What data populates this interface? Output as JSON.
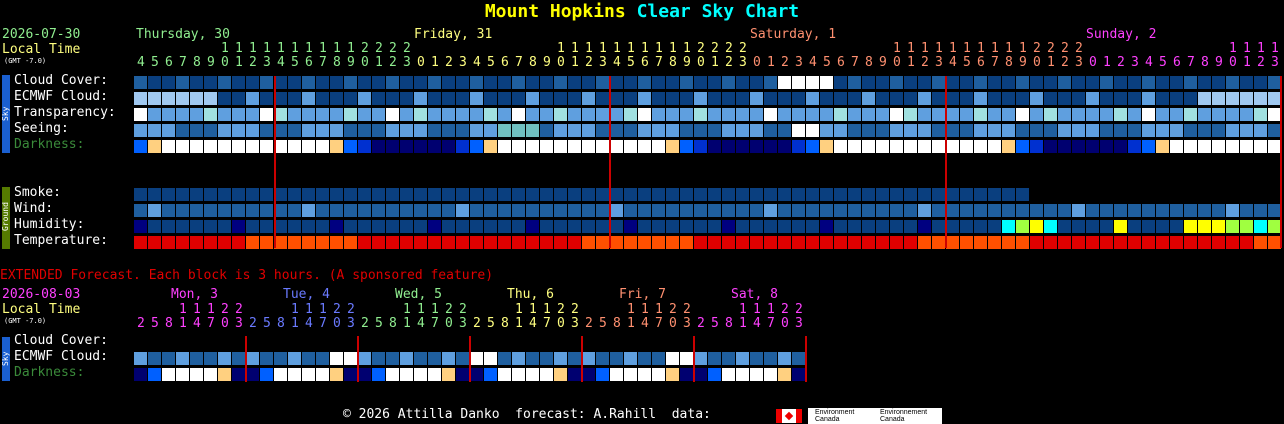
{
  "title": {
    "part1": "Mount Hopkins",
    "part2": "Clear Sky Chart",
    "color1": "#ffff00",
    "color2": "#00ffff"
  },
  "main": {
    "date": "2026-07-30",
    "local_time": "Local Time",
    "gmt": "(GMT -7.0)",
    "days": [
      {
        "label": "Thursday, 30",
        "color": "#90ee90"
      },
      {
        "label": "Friday, 31",
        "color": "#ffff80"
      },
      {
        "label": "Saturday, 1",
        "color": "#ff9070"
      },
      {
        "label": "Sunday, 2",
        "color": "#ff40ff"
      }
    ],
    "hours_tens": [
      " 1111111122222",
      "          1111111111112222",
      "          1111111111112222",
      "          1111111111112222"
    ],
    "hours_units": [
      "4567890123",
      "01234567890123456789",
      "0123456789012345678901 23",
      "0123456789012345678901 23"
    ],
    "sky_tab": "Sky",
    "ground_tab": "Ground",
    "rows": {
      "cloud_cover": "Cloud Cover:",
      "ecmwf": "ECMWF Cloud:",
      "transparency": "Transparency:",
      "seeing": "Seeing:",
      "darkness": "Darkness:",
      "smoke": "Smoke:",
      "wind": "Wind:",
      "humidity": "Humidity:",
      "temperature": "Temperature:"
    },
    "palette": {
      "dblue": "#0a3f7f",
      "mblue": "#1f5f9f",
      "lblue": "#5f9fdf",
      "vlblue": "#a0c8f0",
      "white": "#ffffff",
      "cyanish": "#a0e0e0",
      "teal": "#70c0c0",
      "red": "#e00000",
      "orange": "#ff5000",
      "yellow": "#ffff00",
      "lime": "#a0ff40",
      "cyan": "#00ffff",
      "navy": "#000070",
      "brightblue": "#0060ff"
    }
  },
  "extended": {
    "banner": "EXTENDED Forecast. Each block is 3 hours. (A sponsored feature)",
    "date": "2026-08-03",
    "local_time": "Local Time",
    "gmt": "(GMT -7.0)",
    "days": [
      {
        "label": "Mon, 3",
        "color": "#ff40ff"
      },
      {
        "label": "Tue, 4",
        "color": "#6a7aff"
      },
      {
        "label": "Wed, 5",
        "color": "#90ee90"
      },
      {
        "label": "Thu, 6",
        "color": "#ffff80"
      },
      {
        "label": "Fri, 7",
        "color": "#ff9070"
      },
      {
        "label": "Sat, 8",
        "color": "#ff40ff"
      }
    ],
    "hours_tens": "  11122",
    "hours_units": "25814703",
    "sky_tab": "Sky",
    "rows": {
      "cloud_cover": "Cloud Cover:",
      "ecmwf": "ECMWF Cloud:",
      "darkness": "Darkness:"
    }
  },
  "footer": {
    "text": "© 2026 Attilla Danko  forecast: A.Rahill  data:",
    "logo1": "Environment Canada",
    "logo2": "Environnement Canada"
  }
}
